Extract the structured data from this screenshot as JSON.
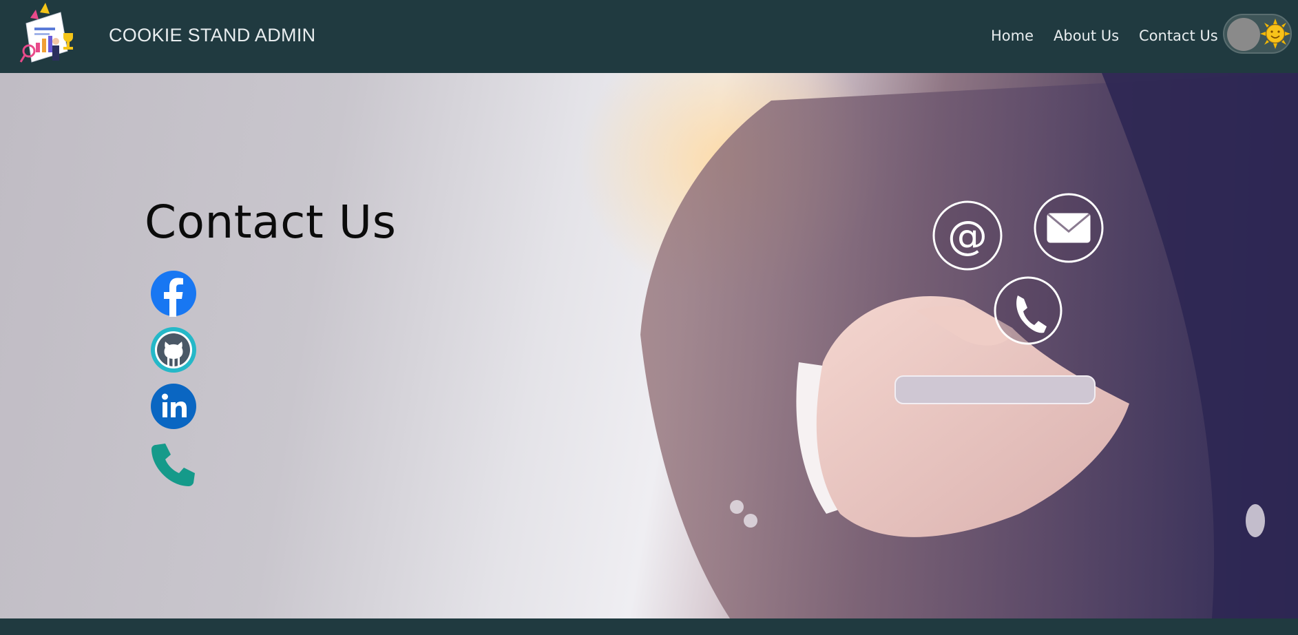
{
  "header": {
    "brand": "COOKIE STAND ADMIN",
    "nav": {
      "home": "Home",
      "about": "About Us",
      "contact": "Contact Us"
    },
    "theme_toggle": {
      "state": "light",
      "icon": "sun-icon"
    },
    "background_color": "#203a40"
  },
  "main": {
    "title": "Contact Us",
    "socials": [
      {
        "name": "facebook",
        "icon": "facebook-icon",
        "color": "#1877f2"
      },
      {
        "name": "github",
        "icon": "github-icon",
        "color": "#24292e"
      },
      {
        "name": "linkedin",
        "icon": "linkedin-icon",
        "color": "#0a66c2"
      },
      {
        "name": "phone",
        "icon": "phone-icon",
        "color": "#159a8a"
      }
    ]
  },
  "colors": {
    "navbar": "#203a40",
    "text_light": "#e9eef0",
    "title_text": "#0b0b0b"
  }
}
